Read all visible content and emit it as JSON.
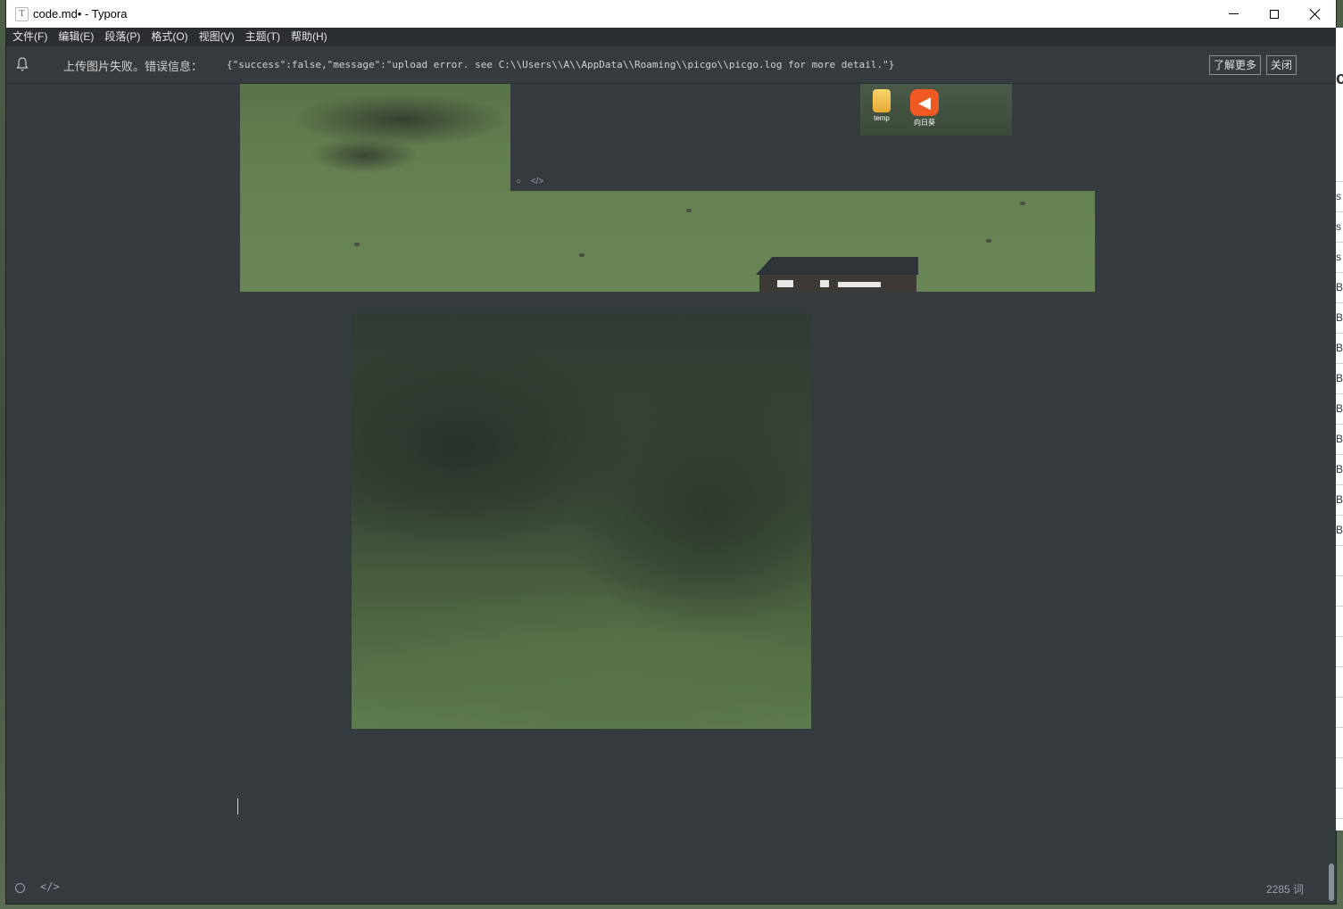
{
  "window": {
    "title": "code.md• - Typora",
    "app_icon_letter": "T"
  },
  "menu": [
    {
      "label": "文件(F)"
    },
    {
      "label": "编辑(E)"
    },
    {
      "label": "段落(P)"
    },
    {
      "label": "格式(O)"
    },
    {
      "label": "视图(V)"
    },
    {
      "label": "主题(T)"
    },
    {
      "label": "帮助(H)"
    }
  ],
  "notification": {
    "message": "上传图片失败。错误信息：",
    "detail": "{\"success\":false,\"message\":\"upload error. see C:\\\\Users\\\\A\\\\AppData\\\\Roaming\\\\picgo\\\\picgo.log for more detail.\"}",
    "learn_more": "了解更多",
    "close": "关闭"
  },
  "embedded_screenshot": {
    "icons": [
      {
        "name": "folder-icon",
        "label": "temp"
      },
      {
        "name": "sunflower-app-icon",
        "label": "向日葵"
      }
    ]
  },
  "status": {
    "word_count": "2285 词"
  },
  "sidebar_sliver": {
    "chars": [
      "c",
      "s",
      "s",
      "s",
      "B",
      "B",
      "B",
      "B",
      "B",
      "B",
      "B",
      "B",
      "B"
    ]
  }
}
